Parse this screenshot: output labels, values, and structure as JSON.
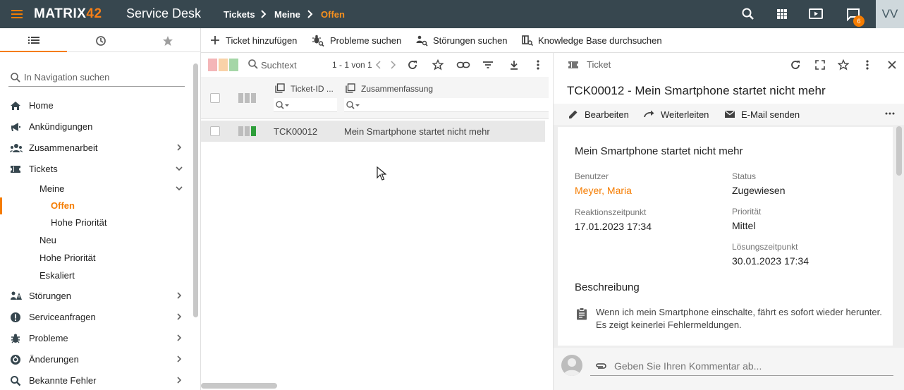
{
  "topbar": {
    "logo_main": "MATRIX",
    "logo_num": "42",
    "app_name": "Service Desk",
    "breadcrumb": [
      "Tickets",
      "Meine",
      "Offen"
    ],
    "notification_count": "6",
    "user_initials": "VV",
    "icons": [
      "menu-icon",
      "search-icon",
      "apps-grid-icon",
      "presentation-icon",
      "notification-icon"
    ]
  },
  "nav": {
    "tabs": [
      "list-icon",
      "history-icon",
      "star-icon"
    ],
    "search_placeholder": "In Navigation suchen",
    "items": [
      {
        "label": "Home",
        "icon": "home-icon"
      },
      {
        "label": "Ankündigungen",
        "icon": "megaphone-icon"
      },
      {
        "label": "Zusammenarbeit",
        "icon": "group-icon"
      },
      {
        "label": "Tickets",
        "icon": "ticket-icon"
      },
      {
        "label": "Meine"
      },
      {
        "label": "Offen"
      },
      {
        "label": "Hohe Priorität"
      },
      {
        "label": "Neu"
      },
      {
        "label": "Hohe Priorität"
      },
      {
        "label": "Eskaliert"
      },
      {
        "label": "Störungen",
        "icon": "incident-icon"
      },
      {
        "label": "Serviceanfragen",
        "icon": "request-icon"
      },
      {
        "label": "Probleme",
        "icon": "bug-icon"
      },
      {
        "label": "Änderungen",
        "icon": "change-icon"
      },
      {
        "label": "Bekannte Fehler",
        "icon": "known-error-icon"
      }
    ]
  },
  "actions": {
    "add_ticket": "Ticket hinzufügen",
    "search_problems": "Probleme suchen",
    "search_incidents": "Störungen suchen",
    "search_kb": "Knowledge Base durchsuchen"
  },
  "list": {
    "search_placeholder": "Suchtext",
    "paging": "1 - 1 von 1",
    "columns": [
      "Ticket-ID ...",
      "Zusammenfassung"
    ],
    "rows": [
      {
        "id": "TCK00012",
        "summary": "Mein Smartphone startet nicht mehr"
      }
    ],
    "colors": {
      "red": "#f4b6b8",
      "orange": "#f9d2a8",
      "green": "#a5d6a7",
      "priority_green": "#2e9e3a"
    }
  },
  "detail": {
    "header_label": "Ticket",
    "title": "TCK00012 - Mein Smartphone startet nicht mehr",
    "actions": {
      "edit": "Bearbeiten",
      "forward": "Weiterleiten",
      "email": "E-Mail senden"
    },
    "card_title": "Mein Smartphone startet nicht mehr",
    "fields": {
      "user_label": "Benutzer",
      "user_value": "Meyer, Maria",
      "status_label": "Status",
      "status_value": "Zugewiesen",
      "reaction_label": "Reaktionszeitpunkt",
      "reaction_value": "17.01.2023 17:34",
      "priority_label": "Priorität",
      "priority_value": "Mittel",
      "solution_label": "Lösungszeitpunkt",
      "solution_value": "30.01.2023 17:34"
    },
    "description_heading": "Beschreibung",
    "description_text": "Wenn ich mein Smartphone einschalte, fährt es sofort wieder herunter. Es zeigt keinerlei Fehlermeldungen.",
    "comment_placeholder": "Geben Sie Ihren Kommentar ab..."
  }
}
